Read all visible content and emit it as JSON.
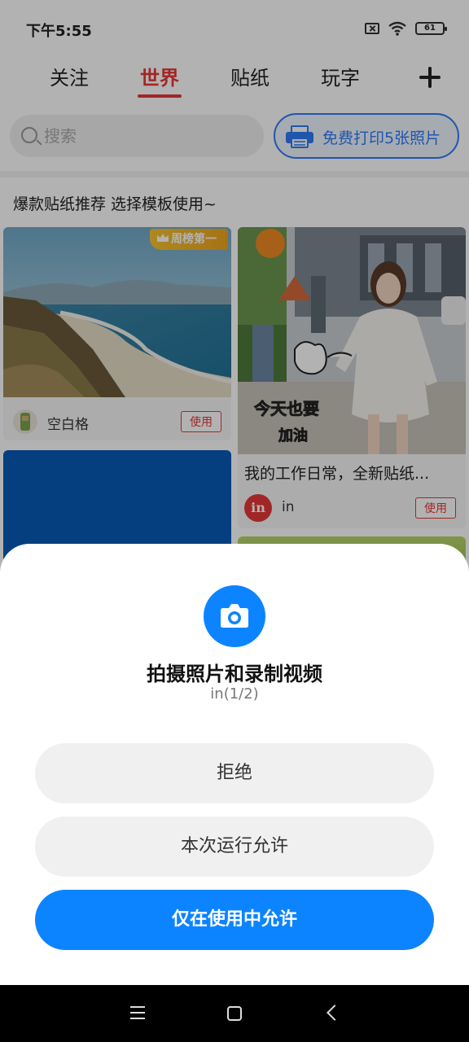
{
  "status_bar": {
    "time": "下午5:55",
    "battery": "61"
  },
  "tabs": [
    {
      "label": "关注",
      "active": false
    },
    {
      "label": "世界",
      "active": true
    },
    {
      "label": "贴纸",
      "active": false
    },
    {
      "label": "玩字",
      "active": false
    }
  ],
  "search": {
    "placeholder": "搜索"
  },
  "print_promo": {
    "label": "免费打印5张照片"
  },
  "section": {
    "title": "爆款贴纸推荐 选择模板使用~"
  },
  "cards": [
    {
      "badge": "周榜第一",
      "author": "空白格",
      "use_label": "使用"
    },
    {
      "title": "我的工作日常，全新贴纸...",
      "author": "in",
      "use_label": "使用",
      "sticker_text": "今天也要 加油"
    }
  ],
  "permission_dialog": {
    "title": "拍摄照片和录制视频",
    "subtitle": "in(1/2)",
    "deny_label": "拒绝",
    "allow_once_label": "本次运行允许",
    "allow_while_using_label": "仅在使用中允许"
  },
  "colors": {
    "accent_red": "#e53935",
    "primary_blue": "#0d84ff",
    "promo_blue": "#2f7cf6"
  }
}
